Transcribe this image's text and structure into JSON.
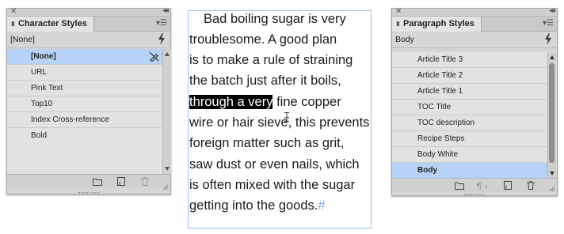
{
  "character_panel": {
    "title": "Character Styles",
    "current": "[None]",
    "items": [
      {
        "label": "[None]",
        "selected": true
      },
      {
        "label": "URL",
        "selected": false
      },
      {
        "label": "Pink Text",
        "selected": false
      },
      {
        "label": "Top10",
        "selected": false
      },
      {
        "label": "Index Cross-reference",
        "selected": false
      },
      {
        "label": "Bold",
        "selected": false
      }
    ],
    "bottom_icons": [
      "folder-icon",
      "new-style-icon",
      "trash-icon"
    ]
  },
  "paragraph_panel": {
    "title": "Paragraph Styles",
    "current": "Body",
    "items": [
      {
        "label": "Article Title 3",
        "selected": false
      },
      {
        "label": "Article Title 2",
        "selected": false
      },
      {
        "label": "Article Title 1",
        "selected": false
      },
      {
        "label": "TOC Title",
        "selected": false
      },
      {
        "label": "TOC description",
        "selected": false
      },
      {
        "label": "Recipe Steps",
        "selected": false
      },
      {
        "label": "Body White",
        "selected": false
      },
      {
        "label": "Body",
        "selected": true
      }
    ],
    "bottom_icons": [
      "folder-icon",
      "clear-overrides-icon",
      "new-style-icon",
      "trash-icon"
    ]
  },
  "text_frame": {
    "lines": [
      {
        "before": "Bad boiling sugar is very",
        "selected": "",
        "after": ""
      },
      {
        "before": "troublesome. A good plan",
        "selected": "",
        "after": ""
      },
      {
        "before": "is to make a rule of straining",
        "selected": "",
        "after": ""
      },
      {
        "before": "the batch just after it boils,",
        "selected": "",
        "after": ""
      },
      {
        "before": "",
        "selected": "through a very",
        "after": " fine copper"
      },
      {
        "before": "wire or hair sieve, this prevents",
        "selected": "",
        "after": ""
      },
      {
        "before": "foreign matter such as grit,",
        "selected": "",
        "after": ""
      },
      {
        "before": "saw dust or even nails, which",
        "selected": "",
        "after": ""
      },
      {
        "before": "is often mixed with the sugar",
        "selected": "",
        "after": ""
      },
      {
        "before": "getting into the goods.",
        "selected": "",
        "after": "#"
      }
    ]
  },
  "colors": {
    "selection_row": "#b6d3f7",
    "frame_border": "#9dbde8",
    "text_highlight": "#000000"
  }
}
